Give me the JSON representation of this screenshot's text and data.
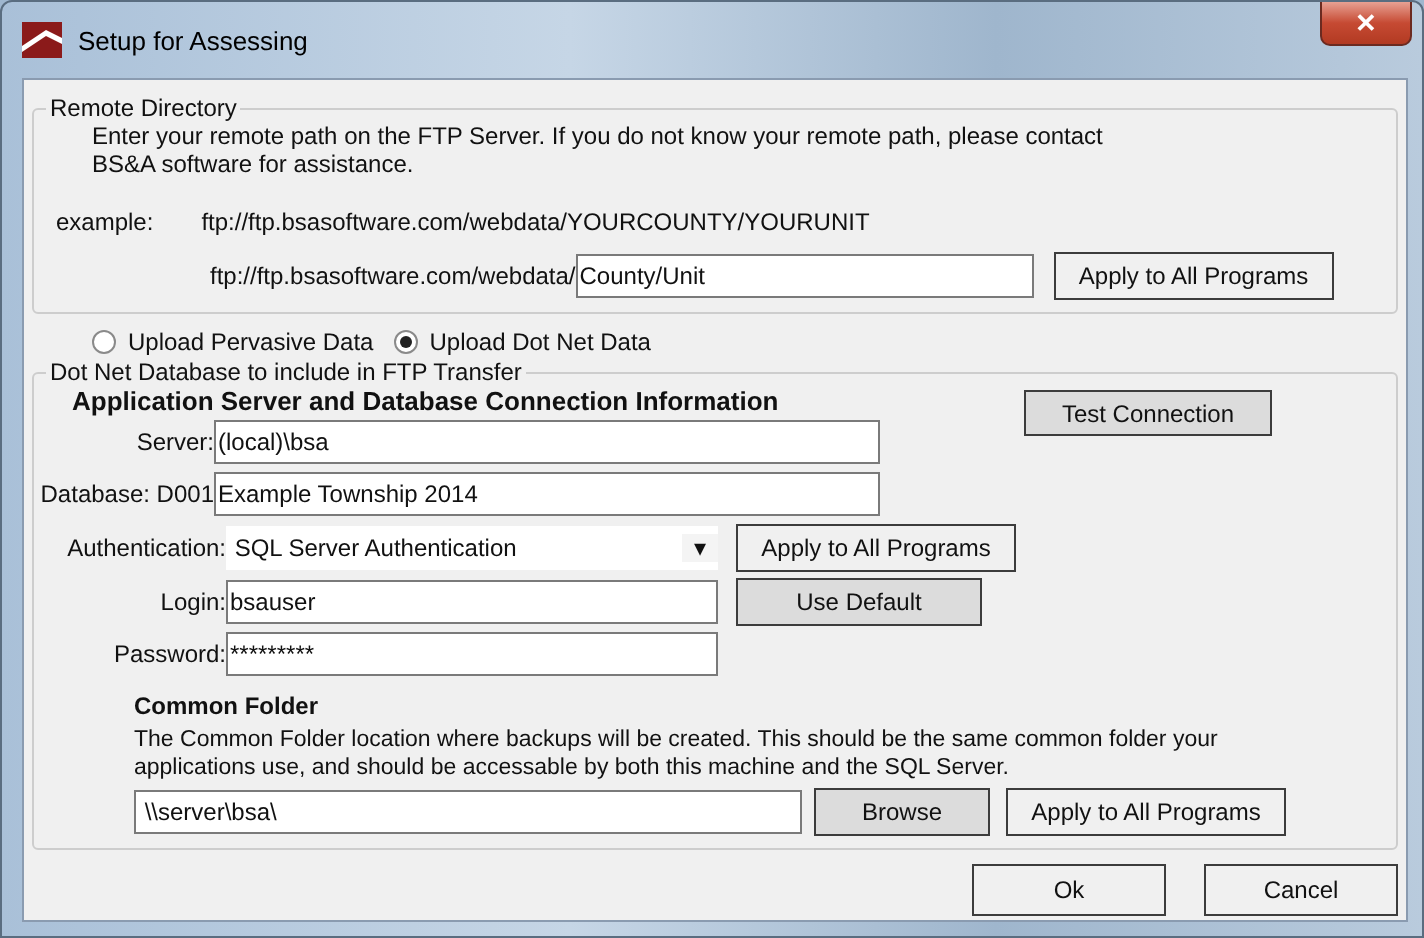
{
  "window": {
    "title": "Setup for Assessing",
    "close": "✕"
  },
  "remote_directory": {
    "legend": "Remote Directory",
    "instructions": "Enter your remote path on the FTP Server.  If you do not know your remote path, please contact BS&A software for assistance.",
    "example_label": "example:",
    "example_value": "ftp://ftp.bsasoftware.com/webdata/YOURCOUNTY/YOURUNIT",
    "path_prefix": "ftp://ftp.bsasoftware.com/webdata/",
    "path_value": "County/Unit",
    "apply_button": "Apply to All Programs"
  },
  "upload_options": [
    {
      "label": "Upload Pervasive Data",
      "selected": false
    },
    {
      "label": "Upload Dot Net Data",
      "selected": true
    }
  ],
  "dot_net": {
    "legend": "Dot Net Database to include in FTP Transfer",
    "heading": "Application Server and Database Connection Information",
    "test_button": "Test Connection",
    "server": {
      "label": "Server:",
      "value": "(local)\\bsa"
    },
    "database": {
      "label": "Database: D001",
      "value": "Example Township 2014"
    },
    "authentication": {
      "label": "Authentication:",
      "value": "SQL Server Authentication",
      "caret": "▾"
    },
    "apply_button": "Apply to All Programs",
    "login": {
      "label": "Login:",
      "value": "bsauser"
    },
    "use_default_button": "Use Default",
    "password": {
      "label": "Password:",
      "value": "*********"
    },
    "common_folder": {
      "heading": "Common Folder",
      "description": "The Common Folder location where backups will be created. This should be the same common folder your applications use, and should be accessable by both this machine and the SQL Server.",
      "value": "\\\\server\\bsa\\",
      "browse_button": "Browse",
      "apply_button": "Apply to All Programs"
    }
  },
  "buttons": [
    "Ok",
    "Cancel"
  ]
}
